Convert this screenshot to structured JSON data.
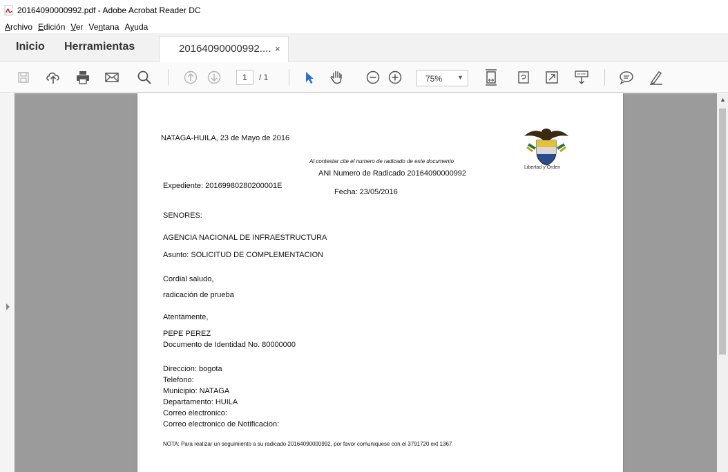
{
  "window": {
    "title": "20164090000992.pdf - Adobe Acrobat Reader DC"
  },
  "menu": [
    {
      "label_pre": "",
      "ul": "A",
      "label_post": "rchivo"
    },
    {
      "label_pre": "",
      "ul": "E",
      "label_post": "dición"
    },
    {
      "label_pre": "",
      "ul": "V",
      "label_post": "er"
    },
    {
      "label_pre": "Ve",
      "ul": "n",
      "label_post": "tana"
    },
    {
      "label_pre": "A",
      "ul": "y",
      "label_post": "uda"
    }
  ],
  "tabs": {
    "home": "Inicio",
    "tools": "Herramientas",
    "document": "20164090000992....",
    "close": "×"
  },
  "toolbar": {
    "page_current": "1",
    "page_total": "/ 1",
    "zoom": "75%",
    "zoom_arrow": "▼",
    "icons": [
      "save-icon",
      "upload-icon",
      "print-icon",
      "email-icon",
      "search-icon",
      "page-up-icon",
      "page-down-icon",
      "select-pointer-icon",
      "hand-icon",
      "zoom-out-icon",
      "zoom-in-icon",
      "fit-page-icon",
      "rotate-icon",
      "fullscreen-icon",
      "read-mode-icon",
      "comment-icon",
      "highlight-pen-icon"
    ]
  },
  "document": {
    "place_date": "NATAGA-HUILA, 23 de Mayo de 2016",
    "cite_note": "Al contestar cite el numero de radicado de este documento",
    "radicado": "ANI Numero de Radicado 20164090000992",
    "expediente": "Expediente: 20169980280200001E",
    "fecha": "Fecha: 23/05/2016",
    "senores": "SENORES:",
    "agency": "AGENCIA NACIONAL DE INFRAESTRUCTURA",
    "asunto": "Asunto: SOLICITUD DE COMPLEMENTACION",
    "saludo": "Cordial saludo,",
    "body": "radicación de prueba",
    "cierre": "Atentamente,",
    "signer_name": "PEPE PEREZ",
    "signer_id": "Documento de Identidad No. 80000000",
    "direccion": "Direccion: bogota",
    "telefono": "Telefono:",
    "municipio": "Municipio: NATAGA",
    "departamento": "Departamento:  HUILA",
    "correo": "Correo electronico:",
    "correo_notif": "Correo electronico de Notificacion:",
    "nota": "NOTA: Para realizar un seguimiento a su radicado 20164090000992, por favor comuniquese con el 3791720 ext 1367",
    "seal_caption": "Libertad y Orden"
  },
  "scroll": {
    "up": "▲"
  },
  "colors": {
    "accent_blue": "#2c6fd6",
    "toolbar_icon": "#555555",
    "disabled_icon": "#b5b5b5",
    "gray_bg": "#9b9b9b",
    "pdf_red": "#d21f1f"
  }
}
